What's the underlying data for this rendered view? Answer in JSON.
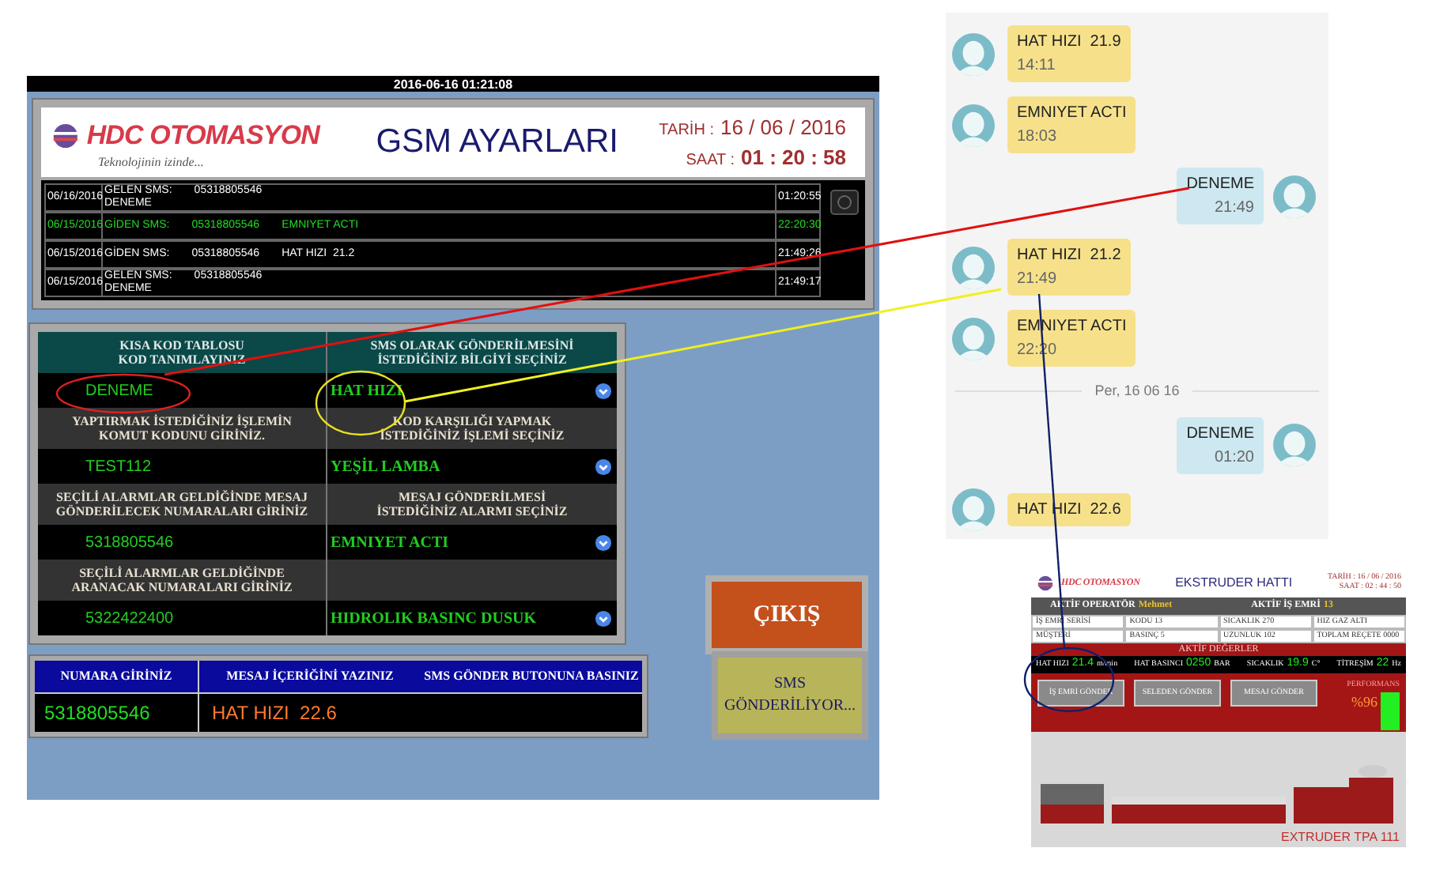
{
  "hmi": {
    "window_title": "2016-06-16 01:21:08",
    "logo": "HDC OTOMASYON",
    "tagline": "Teknolojinin izinde...",
    "title": "GSM AYARLARI",
    "date_label": "TARİH :",
    "date": "16 / 06 / 2016",
    "time_label": "SAAT :",
    "time": "01 : 20 : 58",
    "log": [
      {
        "kind": "incoming",
        "highlighted": false,
        "date": "06/16/2016",
        "type": "GELEN SMS:",
        "number": "05318805546",
        "message": "DENEME",
        "time": "01:20:55"
      },
      {
        "kind": "outgoing",
        "highlighted": true,
        "date": "06/15/2016",
        "type": "GİDEN SMS:",
        "number": "05318805546",
        "message": "EMNIYET ACTI",
        "time": "22:20:30"
      },
      {
        "kind": "outgoing",
        "highlighted": false,
        "date": "06/15/2016",
        "type": "GİDEN SMS:",
        "number": "05318805546",
        "message": "HAT HIZI  21.2",
        "time": "21:49:26"
      },
      {
        "kind": "incoming",
        "highlighted": false,
        "date": "06/15/2016",
        "type": "GELEN SMS:",
        "number": "05318805546",
        "message": "DENEME",
        "time": "21:49:17"
      }
    ],
    "code_table": [
      {
        "left_label": [
          "KISA KOD TABLOSU",
          "KOD TANIMLAYINIZ"
        ],
        "left_value": "DENEME",
        "right_label": [
          "SMS OLARAK GÖNDERİLMESİNİ",
          "İSTEDİĞİNİZ BİLGİYİ SEÇİNİZ"
        ],
        "right_value": "HAT HIZI"
      },
      {
        "left_label": [
          "YAPTIRMAK İSTEDİĞİNİZ İŞLEMİN",
          "KOMUT KODUNU GİRİNİZ."
        ],
        "left_value": "TEST112",
        "right_label": [
          "KOD KARŞILIĞI YAPMAK",
          "İSTEDİĞİNİZ İŞLEMİ SEÇİNİZ"
        ],
        "right_value": "YEŞİL LAMBA"
      },
      {
        "left_label": [
          "SEÇİLİ ALARMLAR GELDİĞİNDE MESAJ",
          "GÖNDERİLECEK NUMARALARI GİRİNİZ"
        ],
        "left_value": "5318805546",
        "right_label": [
          "MESAJ GÖNDERİLMESİ",
          "İSTEDİĞİNİZ ALARMI SEÇİNİZ"
        ],
        "right_value": "EMNIYET ACTI"
      },
      {
        "left_label": [
          "SEÇİLİ ALARMLAR GELDİĞİNDE",
          "ARANACAK NUMARALARI GİRİNİZ"
        ],
        "left_value": "5322422400",
        "right_value": "HIDROLIK BASINC DUSUK"
      }
    ],
    "send": {
      "number_label": "NUMARA GİRİNİZ",
      "message_label": "MESAJ İÇERİĞİNİ YAZINIZ",
      "button_hint": "SMS GÖNDER BUTONUNA BASINIZ",
      "number": "5318805546",
      "message": "HAT HIZI  22.6"
    },
    "exit_button": "ÇIKIŞ",
    "sms_button": "SMS GÖNDERİLİYOR..."
  },
  "chat": {
    "messages": [
      {
        "kind": "received",
        "text": "HAT HIZI  21.9",
        "time": "14:11"
      },
      {
        "kind": "received",
        "text": "EMNIYET ACTI",
        "time": "18:03"
      },
      {
        "kind": "sent",
        "text": "DENEME",
        "time": "21:49"
      },
      {
        "kind": "received",
        "text": "HAT HIZI  21.2",
        "time": "21:49"
      },
      {
        "kind": "received",
        "text": "EMNIYET ACTI",
        "time": "22:20"
      },
      {
        "kind": "divider",
        "text": "Per, 16 06 16"
      },
      {
        "kind": "sent",
        "text": "DENEME",
        "time": "01:20"
      },
      {
        "kind": "received",
        "text": "HAT HIZI  22.6"
      }
    ]
  },
  "inset": {
    "logo": "HDC OTOMASYON",
    "title": "EKSTRUDER HATTI",
    "date": "TARİH : 16 / 06 / 2016",
    "time": "SAAT : 02 : 44 : 50",
    "operator_label": "AKTİF OPERATÖR",
    "operator": "Mehmet",
    "order_label": "AKTİF İŞ EMRİ",
    "order": "13",
    "info": [
      "İŞ EMRİ SERİSİ",
      "KODU 13",
      "SICAKLIK 270",
      "HIZ  GAZ ALTI",
      "MÜŞTERİ",
      "BASINÇ 5",
      "UZUNLUK 102",
      "TOPLAM REÇETE 0000"
    ],
    "values_title": "AKTİF DEĞERLER",
    "values": [
      {
        "label": "HAT HIZI",
        "value": "21.4",
        "unit": "m/min"
      },
      {
        "label": "HAT BASINCI",
        "value": "0250",
        "unit": "BAR"
      },
      {
        "label": "SICAKLIK",
        "value": "19.9",
        "unit": "C°"
      },
      {
        "label": "TİTREŞİM",
        "value": "22",
        "unit": "Hz"
      }
    ],
    "buttons": [
      "İŞ EMRİ GÖNDER",
      "SELEDEN GÖNDER",
      "MESAJ GÖNDER"
    ],
    "performance_label": "PERFORMANS",
    "performance": "%96",
    "machine_label": "EXTRUDER TPA 111"
  }
}
